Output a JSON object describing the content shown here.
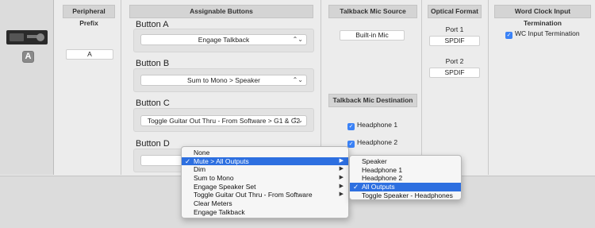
{
  "device": {
    "badge": "A"
  },
  "peripheral_prefix": {
    "header": "Peripheral Prefix",
    "value": "A"
  },
  "assignable_buttons": {
    "header": "Assignable Buttons",
    "buttons": [
      {
        "label": "Button A",
        "value": "Engage Talkback"
      },
      {
        "label": "Button B",
        "value": "Sum to Mono > Speaker"
      },
      {
        "label": "Button C",
        "value": "Toggle Guitar Out Thru - From Software > G1 & G2"
      },
      {
        "label": "Button D",
        "value": ""
      }
    ],
    "popup_arrows": "⌃⌄"
  },
  "talkback_mic_source": {
    "header": "Talkback Mic Source",
    "value": "Built-in Mic"
  },
  "talkback_mic_destination": {
    "header": "Talkback Mic Destination",
    "items": [
      {
        "label": "Headphone 1",
        "checked": true
      },
      {
        "label": "Headphone 2",
        "checked": true
      }
    ]
  },
  "optical_format": {
    "header": "Optical Format",
    "ports": [
      {
        "label": "Port 1",
        "value": "SPDIF"
      },
      {
        "label": "Port 2",
        "value": "SPDIF"
      }
    ]
  },
  "word_clock": {
    "header": "Word Clock Input Termination",
    "label": "WC Input Termination",
    "checked": true
  },
  "context_menu": {
    "items": [
      {
        "label": "None",
        "checked": false,
        "submenu": false
      },
      {
        "label": "Mute > All Outputs",
        "checked": true,
        "submenu": true,
        "selected": true
      },
      {
        "label": "Dim",
        "checked": false,
        "submenu": true
      },
      {
        "label": "Sum to Mono",
        "checked": false,
        "submenu": true
      },
      {
        "label": "Engage Speaker Set",
        "checked": false,
        "submenu": true
      },
      {
        "label": "Toggle Guitar Out Thru - From Software",
        "checked": false,
        "submenu": true
      },
      {
        "label": "Clear Meters",
        "checked": false,
        "submenu": false
      },
      {
        "label": "Engage Talkback",
        "checked": false,
        "submenu": false
      }
    ],
    "check_glyph": "✓",
    "submenu_glyph": "▶"
  },
  "submenu": {
    "items": [
      {
        "label": "Speaker",
        "checked": false
      },
      {
        "label": "Headphone 1",
        "checked": false
      },
      {
        "label": "Headphone 2",
        "checked": false
      },
      {
        "label": "All Outputs",
        "checked": true,
        "selected": true
      },
      {
        "label": "Toggle Speaker - Headphones",
        "checked": false
      }
    ]
  },
  "colors": {
    "selection": "#2d6fe0",
    "checkbox": "#3b82f6"
  }
}
